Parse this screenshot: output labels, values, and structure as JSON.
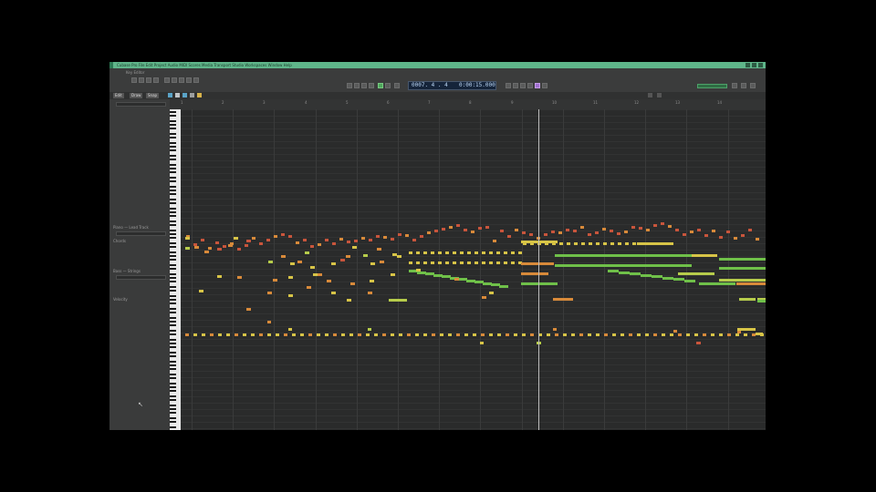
{
  "window": {
    "title_text": "Cubase Pro  File  Edit  Project  Audio  MIDI  Scores  Media  Transport  Studio  Workspaces  Window  Help",
    "theme_color": "#5fb58a"
  },
  "toolbar": {
    "secondary_text": "Key Editor",
    "transport_display": {
      "bars": "0007. 4 . 4",
      "time": "0:00:15.000"
    },
    "cpu_meter_color": "#4ea16a",
    "icons": [
      "rewind-icon",
      "forward-icon",
      "stop-icon",
      "play-icon",
      "record-icon",
      "cycle-icon",
      "metronome-icon",
      "snap-icon",
      "quantize-icon"
    ]
  },
  "editor_toolbar": {
    "tabs": [
      "Edit",
      "Draw",
      "Snap"
    ]
  },
  "inspector": {
    "label_1": "Piano — Lead Track",
    "label_2": "Chords",
    "label_3": "Bass — Strings",
    "label_4": "Velocity"
  },
  "ruler": {
    "labels": [
      "1",
      "2",
      "3",
      "4",
      "5",
      "6",
      "7",
      "8",
      "9",
      "10",
      "11",
      "12",
      "13",
      "14"
    ]
  },
  "note_colors": {
    "red": "#c8553c",
    "orange": "#d88a3a",
    "yellow": "#d7c447",
    "yellow_green": "#b6cc4b",
    "green": "#6fc049"
  }
}
